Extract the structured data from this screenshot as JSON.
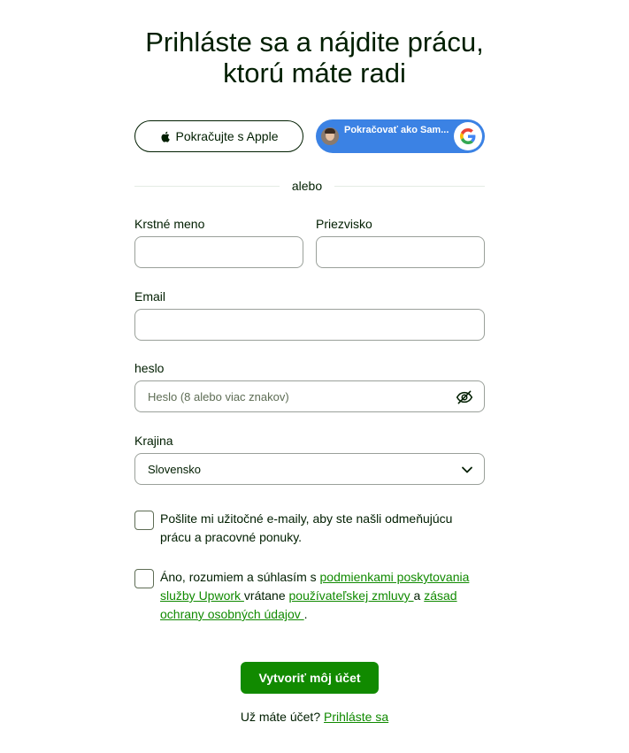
{
  "header": {
    "title_line1": "Prihláste sa a nájdite prácu,",
    "title_line2": "ktorú máte radi"
  },
  "social": {
    "apple_label": "Pokračujte s Apple",
    "google_label": "Pokračovať ako Sam..."
  },
  "divider_text": "alebo",
  "form": {
    "first_name": {
      "label": "Krstné meno",
      "value": "",
      "placeholder": ""
    },
    "last_name": {
      "label": "Priezvisko",
      "value": "",
      "placeholder": ""
    },
    "email": {
      "label": "Email",
      "value": "",
      "placeholder": ""
    },
    "password": {
      "label": "heslo",
      "value": "",
      "placeholder": "Heslo (8 alebo viac znakov)"
    },
    "country": {
      "label": "Krajina",
      "selected": "Slovensko"
    }
  },
  "checkboxes": {
    "emails": {
      "checked": false,
      "line1": "Pošlite mi užitočné e-maily, aby ste našli odmeňujúcu",
      "line2": "prácu a pracovné ponuky."
    },
    "terms": {
      "checked": false,
      "text_start": "Áno, rozumiem a súhlasím s ",
      "link_terms_1": "podmienkami poskytovania",
      "link_terms_2": "služby Upwork ",
      "text_mid": "vrátane ",
      "link_user_agreement": "používateľskej zmluvy ",
      "text_and": "a ",
      "link_privacy_1": "zásad",
      "link_privacy_2": "ochrany osobných údajov ",
      "text_end": "."
    }
  },
  "actions": {
    "create_label": "Vytvoriť môj účet",
    "have_account": "Už máte účet? ",
    "login_link": "Prihláste sa"
  },
  "colors": {
    "brand_green": "#108a00",
    "google_blue": "#3b82e4",
    "text": "#001e00"
  },
  "icons": [
    "apple-icon",
    "google-icon",
    "avatar",
    "eye-slash-icon",
    "chevron-down-icon"
  ]
}
